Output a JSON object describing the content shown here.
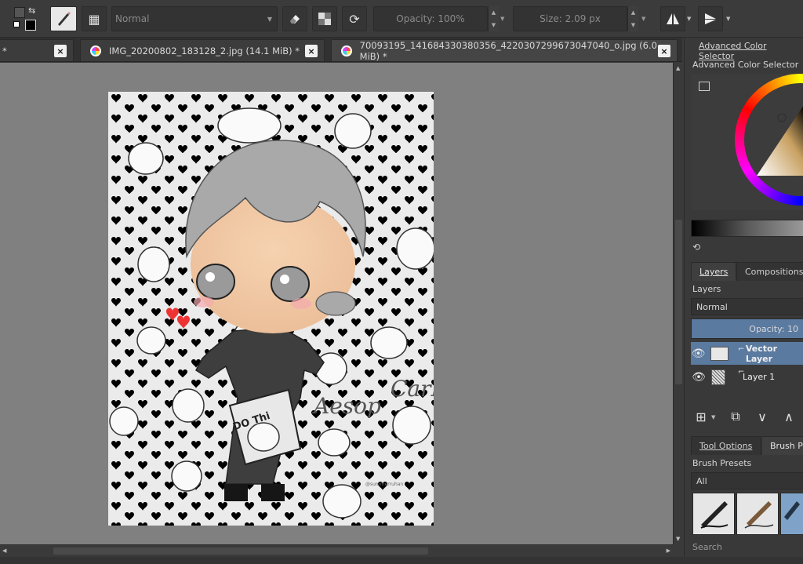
{
  "toolbar": {
    "blend_mode": "Normal",
    "opacity_label": "Opacity: 100%",
    "size_label": "Size: 2.09 px"
  },
  "tabs": [
    {
      "label": "*",
      "close": "×"
    },
    {
      "label": "IMG_20200802_183128_2.jpg (14.1 MiB) *",
      "close": "×"
    },
    {
      "label": "70093195_141684330380356_4220307299673047040_o.jpg (6.0 MiB) *",
      "close": "×"
    }
  ],
  "artwork": {
    "sign_aesop": "Aesop",
    "sign_carl": "CarL",
    "bag_text": "DO Thi",
    "watermark": "@summerruhan"
  },
  "docker": {
    "color_tab_title": "Advanced Color Selector",
    "color_panel_title": "Advanced Color Selector",
    "layers_tab": "Layers",
    "compositions_tab": "Compositions",
    "layers_title": "Layers",
    "blend_mode": "Normal",
    "opacity_label": "Opacity: 10",
    "layers": [
      {
        "name": "Vector Layer",
        "active": true
      },
      {
        "name": "Layer 1",
        "active": false
      }
    ],
    "tool_options_tab": "Tool Options",
    "brush_tab": "Brush Pre",
    "brush_presets_title": "Brush Presets",
    "filter_value": "All",
    "search_label": "Search"
  },
  "colors": {
    "active_layer": "#5a7aa0",
    "canvas_bg": "#808080"
  }
}
